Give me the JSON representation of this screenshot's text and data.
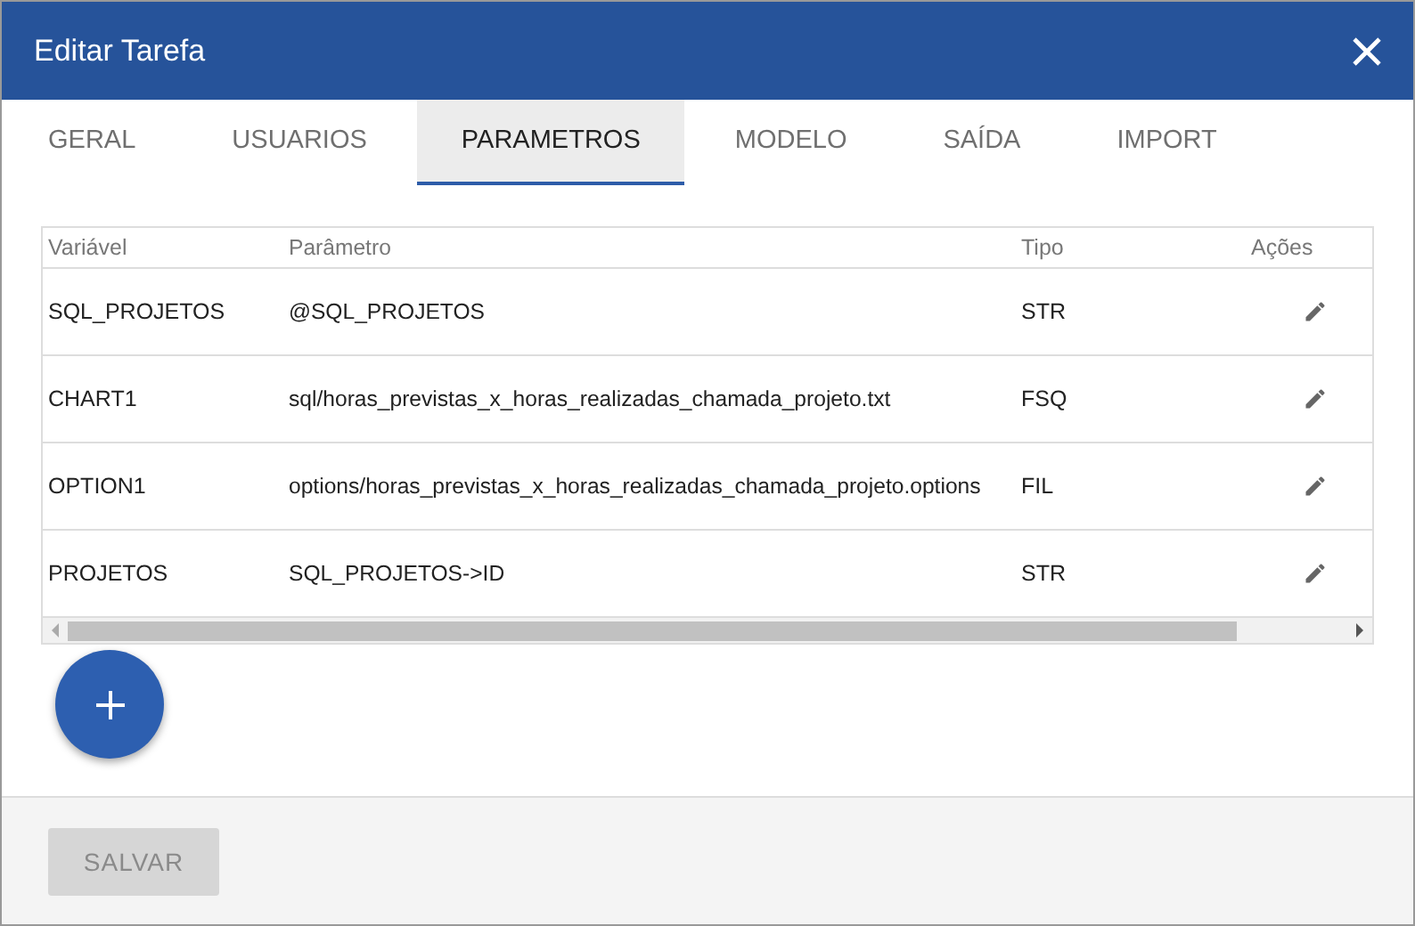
{
  "dialog": {
    "title": "Editar Tarefa"
  },
  "tabs": [
    {
      "label": "GERAL",
      "selected": false
    },
    {
      "label": "USUARIOS",
      "selected": false
    },
    {
      "label": "PARAMETROS",
      "selected": true
    },
    {
      "label": "MODELO",
      "selected": false
    },
    {
      "label": "SAÍDA",
      "selected": false
    },
    {
      "label": "IMPORT",
      "selected": false
    }
  ],
  "table": {
    "columns": [
      "Variável",
      "Parâmetro",
      "Tipo",
      "Ações"
    ],
    "rows": [
      {
        "variable": "SQL_PROJETOS",
        "parameter": "@SQL_PROJETOS",
        "type": "STR"
      },
      {
        "variable": "CHART1",
        "parameter": "sql/horas_previstas_x_horas_realizadas_chamada_projeto.txt",
        "type": "FSQ"
      },
      {
        "variable": "OPTION1",
        "parameter": "options/horas_previstas_x_horas_realizadas_chamada_projeto.options",
        "type": "FIL"
      },
      {
        "variable": "PROJETOS",
        "parameter": "SQL_PROJETOS->ID",
        "type": "STR"
      }
    ]
  },
  "save_button": {
    "label": "SALVAR",
    "disabled": true
  }
}
